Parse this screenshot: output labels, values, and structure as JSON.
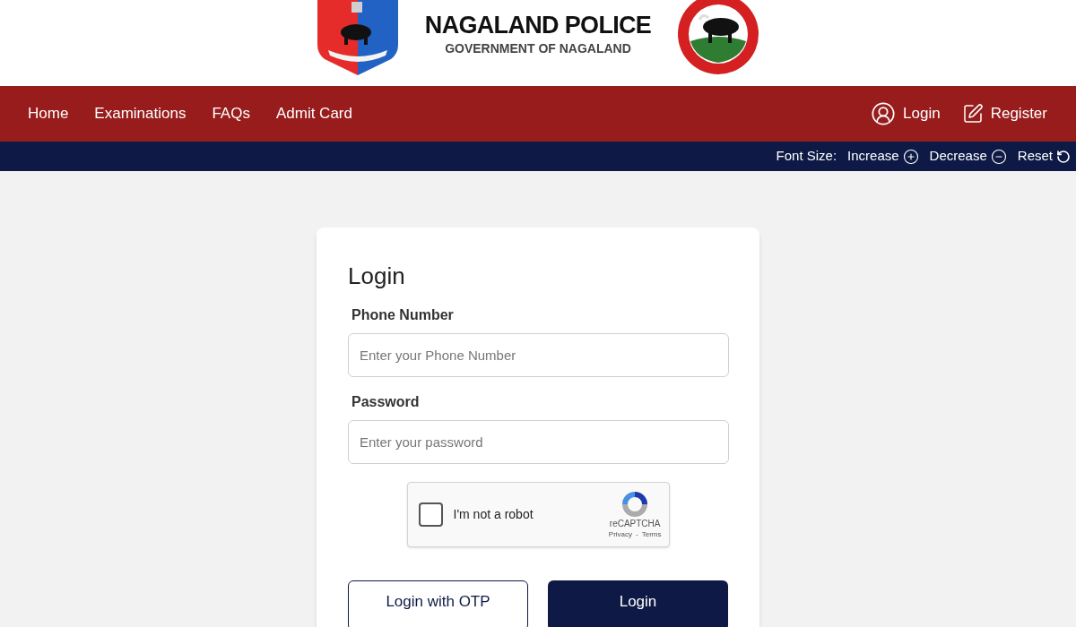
{
  "header": {
    "title": "NAGALAND POLICE",
    "subtitle": "GOVERNMENT OF NAGALAND"
  },
  "nav": {
    "links": [
      {
        "label": "Home"
      },
      {
        "label": "Examinations"
      },
      {
        "label": "FAQs"
      },
      {
        "label": "Admit Card"
      }
    ],
    "actions": [
      {
        "label": "Login",
        "kind": "user"
      },
      {
        "label": "Register",
        "kind": "edit"
      }
    ]
  },
  "font_bar": {
    "label": "Font Size:",
    "controls": [
      {
        "label": "Increase",
        "kind": "plus"
      },
      {
        "label": "Decrease",
        "kind": "minus"
      },
      {
        "label": "Reset",
        "kind": "reset"
      }
    ]
  },
  "login_form": {
    "title": "Login",
    "fields": [
      {
        "label": "Phone Number",
        "placeholder": "Enter your Phone Number"
      },
      {
        "label": "Password",
        "placeholder": "Enter your password"
      }
    ],
    "captcha": {
      "label": "I'm not a robot",
      "checked": false,
      "brand": "reCAPTCHA",
      "links": [
        "Privacy",
        "Terms"
      ],
      "separator": "-"
    },
    "buttons": [
      {
        "label": "Login with OTP",
        "kind": "outline"
      },
      {
        "label": "Login",
        "kind": "primary"
      }
    ]
  }
}
